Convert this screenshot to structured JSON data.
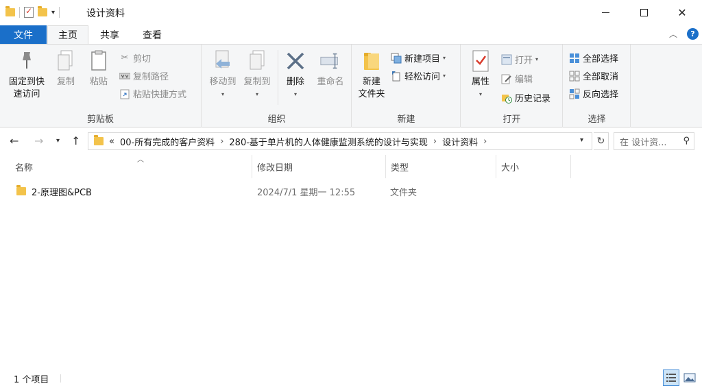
{
  "window": {
    "title": "设计资料"
  },
  "ribbon_tabs": [
    "文件",
    "主页",
    "共享",
    "查看"
  ],
  "ribbon": {
    "clipboard": {
      "label": "剪贴板",
      "pin": "固定到快\n速访问",
      "copy": "复制",
      "paste": "粘贴",
      "cut": "剪切",
      "copy_path": "复制路径",
      "paste_shortcut": "粘贴快捷方式"
    },
    "organize": {
      "label": "组织",
      "move_to": "移动到",
      "copy_to": "复制到",
      "delete": "删除",
      "rename": "重命名"
    },
    "new": {
      "label": "新建",
      "new_folder": "新建\n文件夹",
      "new_item": "新建项目",
      "easy_access": "轻松访问"
    },
    "open": {
      "label": "打开",
      "properties": "属性",
      "open": "打开",
      "edit": "编辑",
      "history": "历史记录"
    },
    "select": {
      "label": "选择",
      "select_all": "全部选择",
      "select_none": "全部取消",
      "invert": "反向选择"
    }
  },
  "address": {
    "overflow": "«",
    "crumbs": [
      "00-所有完成的客户资料",
      "280-基于单片机的人体健康监测系统的设计与实现",
      "设计资料"
    ],
    "search_placeholder": "在 设计资..."
  },
  "columns": {
    "name": "名称",
    "date": "修改日期",
    "type": "类型",
    "size": "大小"
  },
  "files": [
    {
      "name": "2-原理图&PCB",
      "date": "2024/7/1 星期一 12:55",
      "type": "文件夹",
      "size": ""
    }
  ],
  "status": {
    "count": "1 个项目"
  },
  "colors": {
    "accent": "#1a6fc9",
    "folder": "#f3c34b",
    "ribbon_bg": "#f5f6f7"
  }
}
